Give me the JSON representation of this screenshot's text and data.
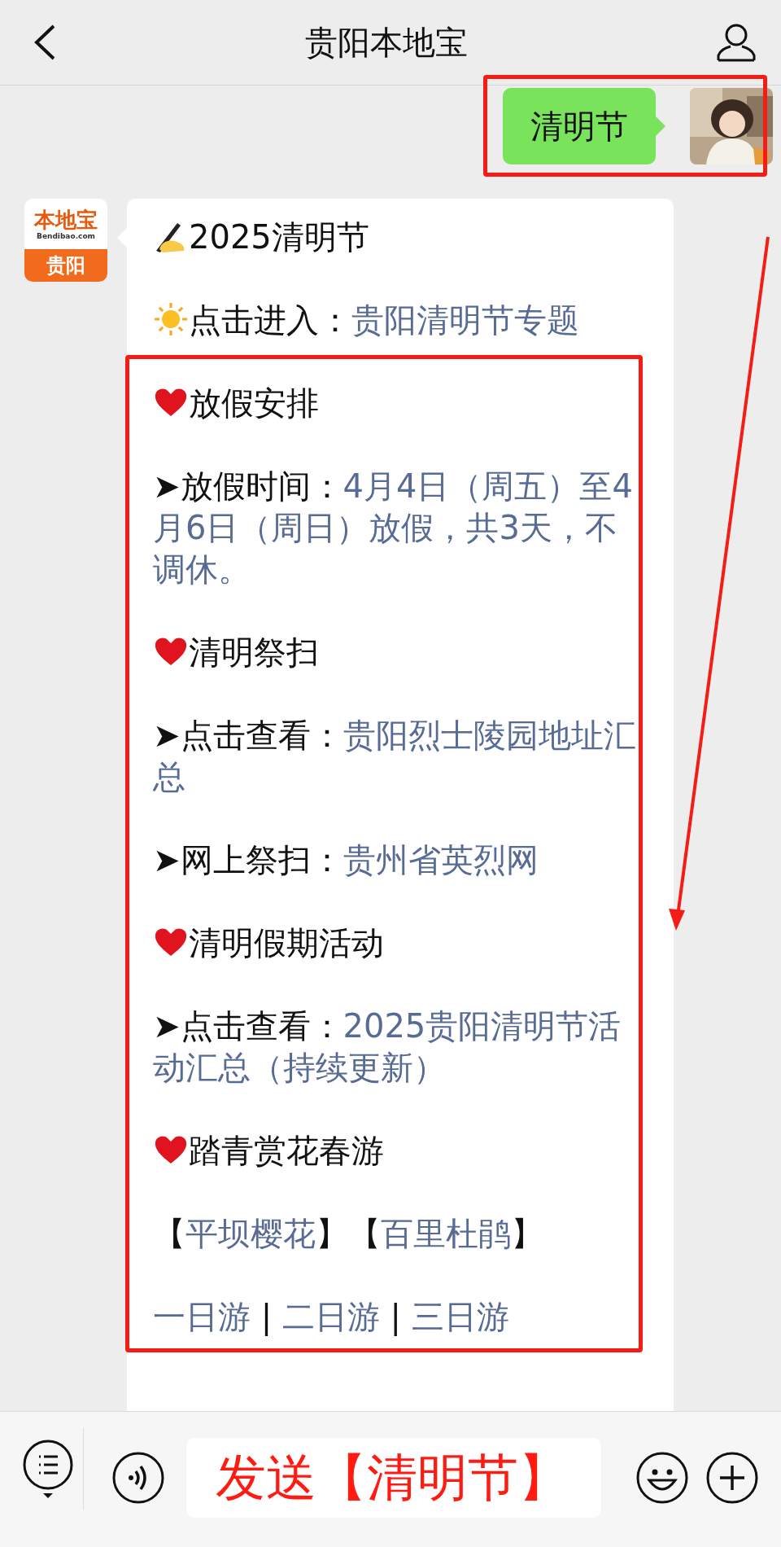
{
  "header": {
    "title": "贵阳本地宝"
  },
  "messages": [
    {
      "kind": "sent",
      "text": "清明节"
    },
    {
      "kind": "received",
      "avatar": {
        "brand": "本地宝",
        "domain": "Bendibao.com",
        "city": "贵阳"
      },
      "paragraphs": [
        {
          "kind": "title",
          "segments": [
            {
              "kind": "plain",
              "text": "2025清明节"
            }
          ]
        },
        {
          "kind": "entry",
          "segments": [
            {
              "kind": "plain",
              "text": "点击进入："
            },
            {
              "kind": "link",
              "text": "贵阳清明节专题"
            }
          ]
        },
        {
          "kind": "section",
          "segments": [
            {
              "kind": "plain",
              "text": "放假安排"
            }
          ]
        },
        {
          "kind": "item",
          "segments": [
            {
              "kind": "plain",
              "text": "➤放假时间："
            },
            {
              "kind": "link",
              "text": "4月4日（周五）至4月6日（周日）放假，共3天，不调休。"
            }
          ]
        },
        {
          "kind": "section",
          "segments": [
            {
              "kind": "plain",
              "text": "清明祭扫"
            }
          ]
        },
        {
          "kind": "item",
          "segments": [
            {
              "kind": "plain",
              "text": "➤点击查看："
            },
            {
              "kind": "link",
              "text": "贵阳烈士陵园地址汇总"
            }
          ]
        },
        {
          "kind": "item",
          "segments": [
            {
              "kind": "plain",
              "text": "➤网上祭扫："
            },
            {
              "kind": "link",
              "text": "贵州省英烈网"
            }
          ]
        },
        {
          "kind": "section",
          "segments": [
            {
              "kind": "plain",
              "text": "清明假期活动"
            }
          ]
        },
        {
          "kind": "item",
          "segments": [
            {
              "kind": "plain",
              "text": "➤点击查看："
            },
            {
              "kind": "link",
              "text": "2025贵阳清明节活动汇总（持续更新）"
            }
          ]
        },
        {
          "kind": "section",
          "segments": [
            {
              "kind": "plain",
              "text": "踏青赏花春游"
            }
          ]
        },
        {
          "kind": "item",
          "segments": [
            {
              "kind": "plain",
              "text": "【"
            },
            {
              "kind": "link",
              "text": "平坝樱花"
            },
            {
              "kind": "plain",
              "text": "】【"
            },
            {
              "kind": "link",
              "text": "百里杜鹃"
            },
            {
              "kind": "plain",
              "text": "】"
            }
          ]
        },
        {
          "kind": "item",
          "segments": [
            {
              "kind": "link",
              "text": "一日游"
            },
            {
              "kind": "plain",
              "text": " | "
            },
            {
              "kind": "link",
              "text": "二日游"
            },
            {
              "kind": "plain",
              "text": " | "
            },
            {
              "kind": "link",
              "text": "三日游"
            }
          ]
        }
      ]
    }
  ],
  "annotations": [
    {
      "kind": "frame"
    },
    {
      "kind": "frame"
    },
    {
      "kind": "arrow"
    }
  ],
  "composer": {
    "value": "发送【清明节】"
  }
}
